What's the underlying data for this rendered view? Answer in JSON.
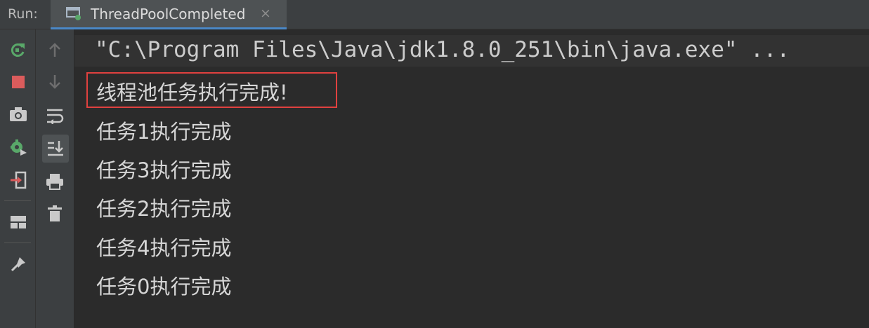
{
  "run_panel": {
    "label": "Run:",
    "tab": {
      "title": "ThreadPoolCompleted",
      "close": "×",
      "icon": "run-config-icon"
    }
  },
  "toolbar_left": [
    {
      "name": "rerun-icon"
    },
    {
      "name": "stop-icon",
      "color": "#db5c5c"
    },
    {
      "name": "camera-icon"
    },
    {
      "name": "debug-settings-icon"
    },
    {
      "name": "exit-icon"
    },
    {
      "name": "layout-icon"
    },
    {
      "name": "pin-icon"
    }
  ],
  "toolbar_right": [
    {
      "name": "up-arrow-icon"
    },
    {
      "name": "down-arrow-icon"
    },
    {
      "name": "soft-wrap-icon"
    },
    {
      "name": "scroll-to-end-icon"
    },
    {
      "name": "print-icon"
    },
    {
      "name": "trash-icon"
    }
  ],
  "console": {
    "command": "\"C:\\Program Files\\Java\\jdk1.8.0_251\\bin\\java.exe\" ...",
    "lines": [
      "线程池任务执行完成!",
      "任务1执行完成",
      "任务3执行完成",
      "任务2执行完成",
      "任务4执行完成",
      "任务0执行完成"
    ],
    "highlight_color": "#e0413f"
  }
}
